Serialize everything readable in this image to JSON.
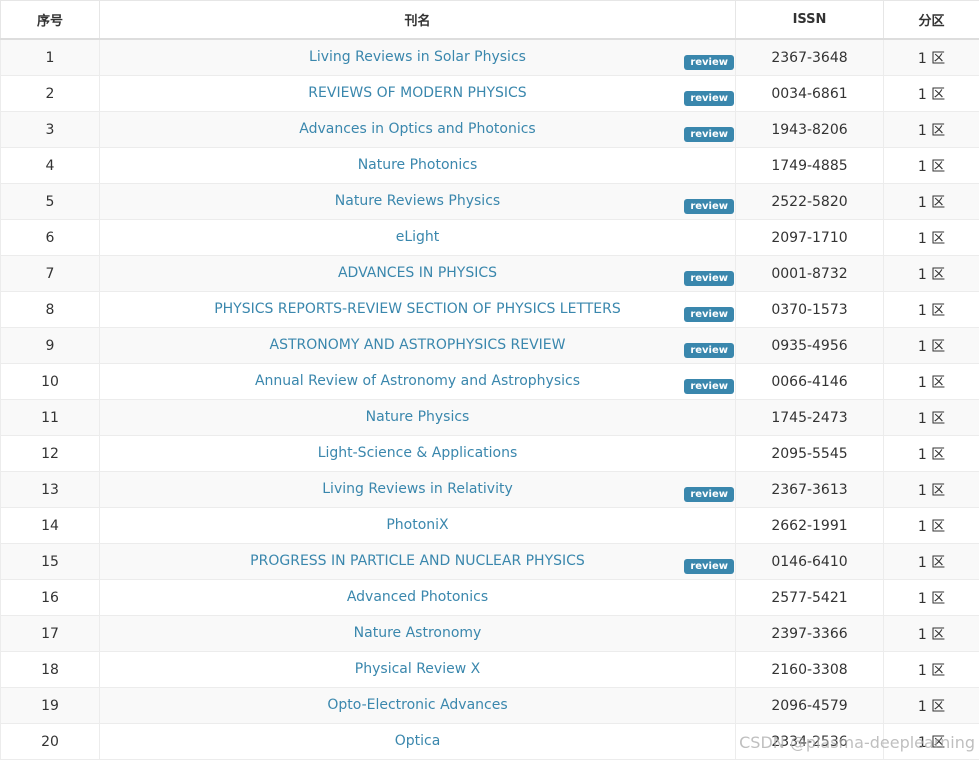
{
  "table": {
    "headers": {
      "index": "序号",
      "name": "刊名",
      "issn": "ISSN",
      "zone": "分区"
    },
    "review_badge_label": "review",
    "accent_color": "#3a87ad",
    "rows": [
      {
        "index": "1",
        "name": "Living Reviews in Solar Physics",
        "review": true,
        "issn": "2367-3648",
        "zone": "1 区"
      },
      {
        "index": "2",
        "name": "REVIEWS OF MODERN PHYSICS",
        "review": true,
        "issn": "0034-6861",
        "zone": "1 区"
      },
      {
        "index": "3",
        "name": "Advances in Optics and Photonics",
        "review": true,
        "issn": "1943-8206",
        "zone": "1 区"
      },
      {
        "index": "4",
        "name": "Nature Photonics",
        "review": false,
        "issn": "1749-4885",
        "zone": "1 区"
      },
      {
        "index": "5",
        "name": "Nature Reviews Physics",
        "review": true,
        "issn": "2522-5820",
        "zone": "1 区"
      },
      {
        "index": "6",
        "name": "eLight",
        "review": false,
        "issn": "2097-1710",
        "zone": "1 区"
      },
      {
        "index": "7",
        "name": "ADVANCES IN PHYSICS",
        "review": true,
        "issn": "0001-8732",
        "zone": "1 区"
      },
      {
        "index": "8",
        "name": "PHYSICS REPORTS-REVIEW SECTION OF PHYSICS LETTERS",
        "review": true,
        "issn": "0370-1573",
        "zone": "1 区"
      },
      {
        "index": "9",
        "name": "ASTRONOMY AND ASTROPHYSICS REVIEW",
        "review": true,
        "issn": "0935-4956",
        "zone": "1 区"
      },
      {
        "index": "10",
        "name": "Annual Review of Astronomy and Astrophysics",
        "review": true,
        "issn": "0066-4146",
        "zone": "1 区"
      },
      {
        "index": "11",
        "name": "Nature Physics",
        "review": false,
        "issn": "1745-2473",
        "zone": "1 区"
      },
      {
        "index": "12",
        "name": "Light-Science & Applications",
        "review": false,
        "issn": "2095-5545",
        "zone": "1 区"
      },
      {
        "index": "13",
        "name": "Living Reviews in Relativity",
        "review": true,
        "issn": "2367-3613",
        "zone": "1 区"
      },
      {
        "index": "14",
        "name": "PhotoniX",
        "review": false,
        "issn": "2662-1991",
        "zone": "1 区"
      },
      {
        "index": "15",
        "name": "PROGRESS IN PARTICLE AND NUCLEAR PHYSICS",
        "review": true,
        "issn": "0146-6410",
        "zone": "1 区"
      },
      {
        "index": "16",
        "name": "Advanced Photonics",
        "review": false,
        "issn": "2577-5421",
        "zone": "1 区"
      },
      {
        "index": "17",
        "name": "Nature Astronomy",
        "review": false,
        "issn": "2397-3366",
        "zone": "1 区"
      },
      {
        "index": "18",
        "name": "Physical Review X",
        "review": false,
        "issn": "2160-3308",
        "zone": "1 区"
      },
      {
        "index": "19",
        "name": "Opto-Electronic Advances",
        "review": false,
        "issn": "2096-4579",
        "zone": "1 区"
      },
      {
        "index": "20",
        "name": "Optica",
        "review": false,
        "issn": "2334-2536",
        "zone": "1 区"
      }
    ]
  },
  "watermark": "CSDN @plasma-deeplearning"
}
